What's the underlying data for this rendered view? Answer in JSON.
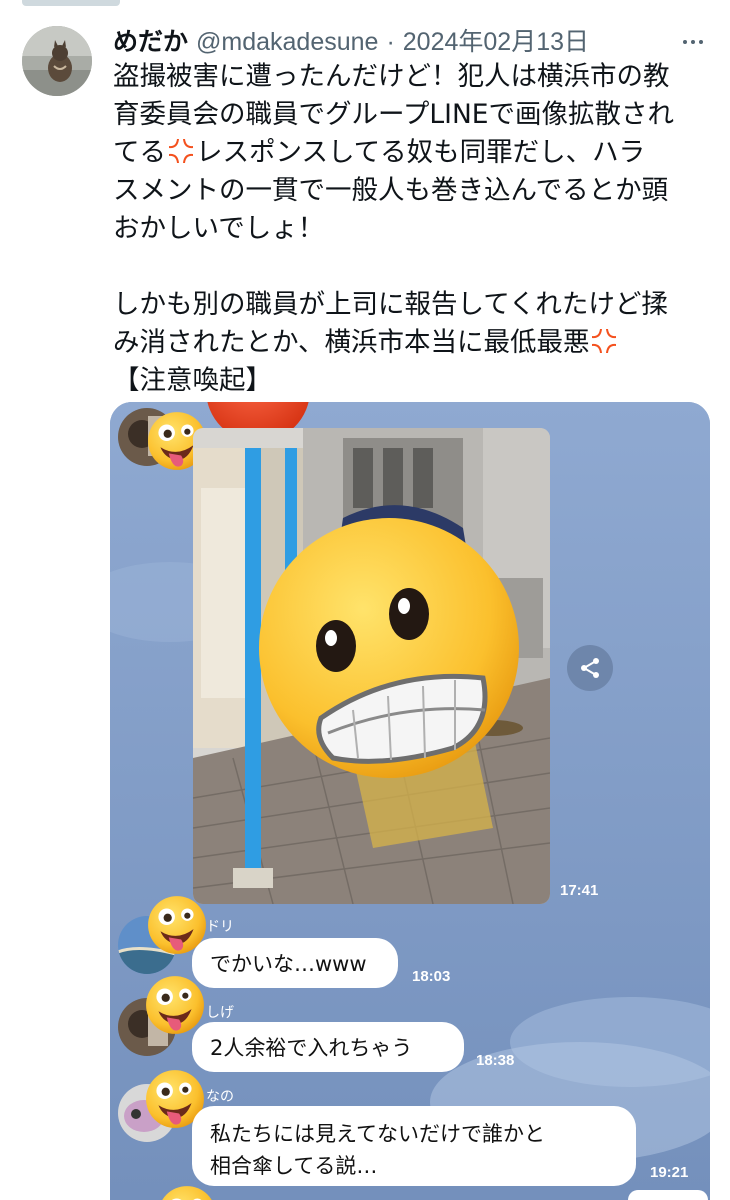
{
  "tweet": {
    "display_name": "めだか",
    "handle": "@mdakadesune",
    "separator": "·",
    "date": "2024年02月13日",
    "text_line_1": "盗撮被害に遭ったんだけど！犯人は横浜市の教",
    "text_line_2": "育委員会の職員でグループLINEで画像拡散され",
    "text_line_3a": "てる",
    "text_line_3b": "レスポンスしてる奴も同罪だし、ハラ",
    "text_line_4": "スメントの一貫で一般人も巻き込んでるとか頭",
    "text_line_5": "おかしいでしょ！",
    "text_line_6": "しかも別の職員が上司に報告してくれたけど揉",
    "text_line_7a": "み消されたとか、横浜市本当に最低最悪",
    "text_line_8": "【注意喚起】"
  },
  "chat": {
    "photo_time": "17:41",
    "messages": [
      {
        "sender": "ドリ",
        "text": "でかいな…www",
        "time": "18:03"
      },
      {
        "sender": "しげ",
        "text": "2人余裕で入れちゃう",
        "time": "18:38"
      },
      {
        "sender": "なの",
        "text_line_1": "私たちには見えてないだけで誰かと",
        "text_line_2": "相合傘してる説…",
        "time": "19:21"
      }
    ]
  },
  "icons": {
    "more": "more-horizontal-icon",
    "anger": "anger-symbol-icon",
    "share": "share-icon",
    "face_sticker": "zany-face-emoji",
    "grimace_sticker": "grimacing-face-emoji",
    "pouting_sticker": "pouting-face-emoji"
  },
  "colors": {
    "text": "#0f1419",
    "secondary": "#536471",
    "line_chat_bg": "#7b97c2",
    "anger": "#f4511e"
  }
}
